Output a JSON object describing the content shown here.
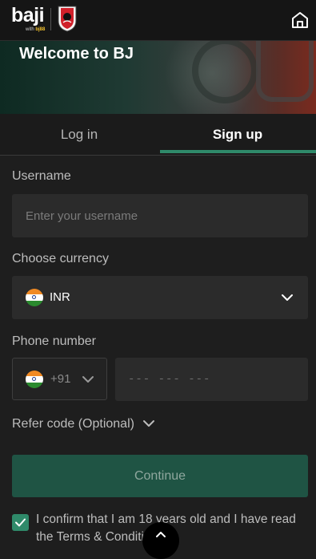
{
  "header": {
    "logo_text": "baji",
    "logo_sub_prefix": "with ",
    "logo_sub_brand": "bj88",
    "club_badge_icon": "club-crest-icon",
    "home_icon": "home-icon"
  },
  "banner": {
    "title": "Welcome to BJ"
  },
  "tabs": {
    "login_label": "Log in",
    "signup_label": "Sign up",
    "active": "signup",
    "accent_color": "#2f8a6a"
  },
  "form": {
    "username": {
      "label": "Username",
      "placeholder": "Enter your username",
      "value": ""
    },
    "currency": {
      "label": "Choose currency",
      "value": "INR",
      "flag_icon": "india-flag-icon"
    },
    "phone": {
      "label": "Phone number",
      "country_code": "+91",
      "placeholder": "--- --- ---",
      "value": ""
    },
    "refer_label": "Refer code (Optional)",
    "continue_label": "Continue",
    "confirm": {
      "checked": true,
      "text": "I confirm that I am 18 years old and I have read the Terms & Conditions"
    }
  },
  "scroll_top_icon": "chevron-up-icon"
}
